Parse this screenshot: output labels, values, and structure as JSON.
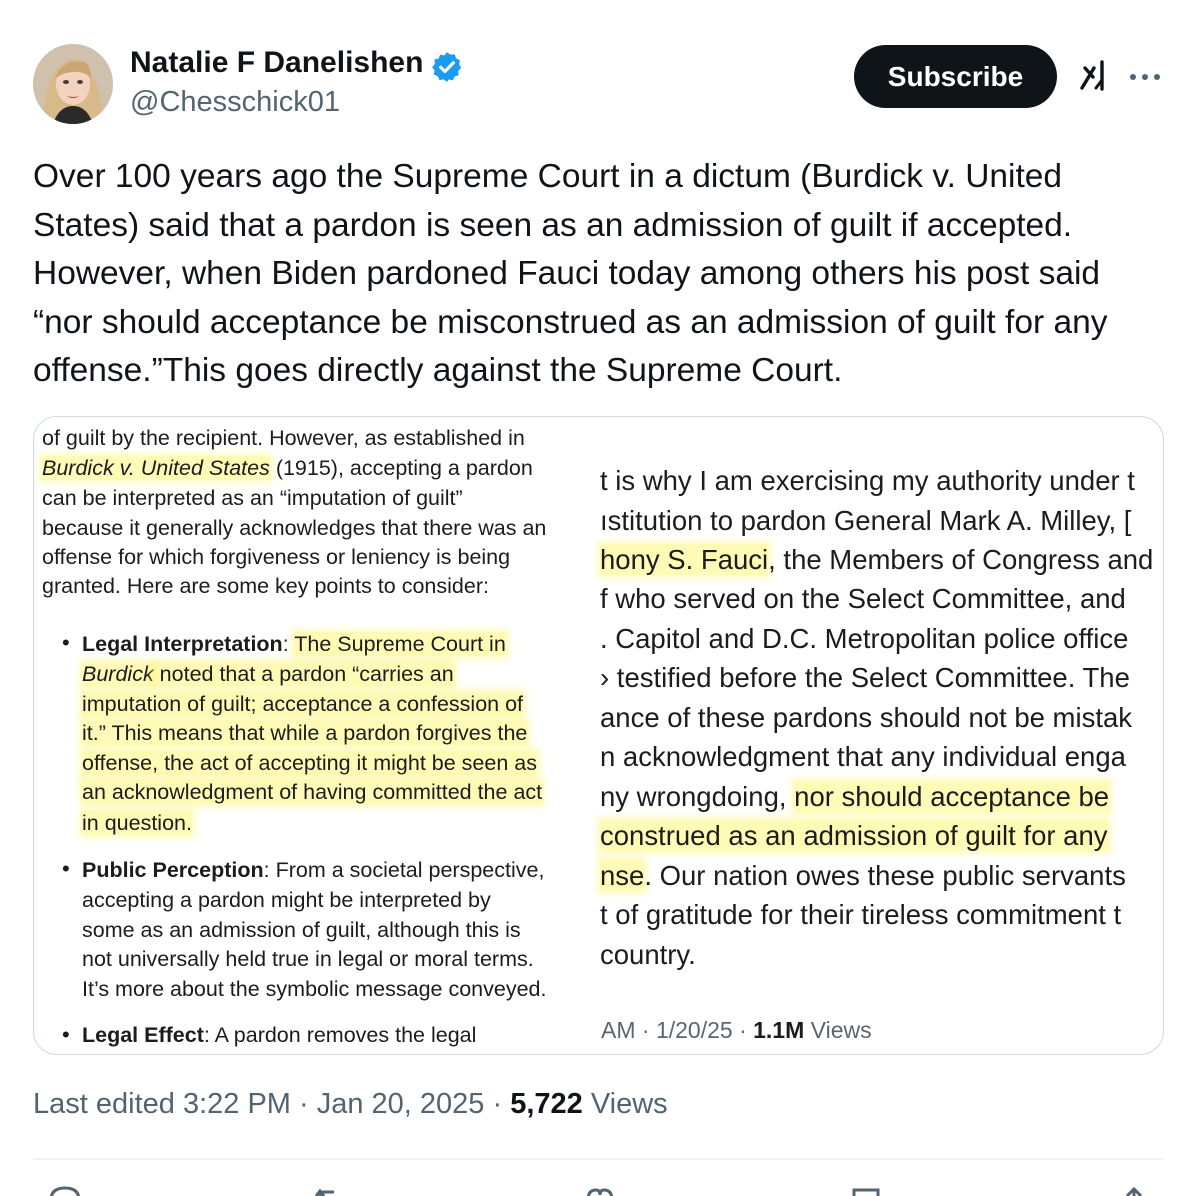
{
  "author": {
    "name": "Natalie F Danelishen",
    "handle": "@Chesschick01",
    "verified_color": "#1d9bf0"
  },
  "header": {
    "subscribe_label": "Subscribe",
    "grok_icon": "grok-icon",
    "more_icon": "more-icon"
  },
  "tweet": {
    "text": "Over 100 years ago the Supreme Court in a dictum (Burdick v. United States) said that a pardon is seen as an admission of guilt if accepted. However, when Biden pardoned Fauci today among others his post said “nor should acceptance be misconstrued as an admission of guilt for any offense.”This goes directly against the Supreme Court."
  },
  "media": {
    "left": {
      "p1": {
        "l1": "of guilt by the recipient. However, as established in",
        "l2_case": "Burdick v. United States",
        "l2_rest": " (1915), accepting a pardon",
        "l3": "can be interpreted as an “imputation of guilt”",
        "l4": "because it generally acknowledges that there was an",
        "l5": "offense for which forgiveness or leniency is being",
        "l6": "granted. Here are some key points to consider:"
      },
      "b1": {
        "title": "Legal Interpretation",
        "l1_rest": "The Supreme Court in",
        "l2_case": "Burdick",
        "l2_rest": " noted that a pardon “carries an",
        "l3": "imputation of guilt; acceptance a confession of",
        "l4": "it.” This means that while a pardon forgives the",
        "l5": "offense, the act of accepting it might be seen as",
        "l6": "an acknowledgment of having committed the act",
        "l7": "in question."
      },
      "b2": {
        "title": "Public Perception",
        "l1_rest": " From a societal perspective,",
        "l2": "accepting a pardon might be interpreted by",
        "l3": "some as an admission of guilt, although this is",
        "l4": "not universally held true in legal or moral terms.",
        "l5": "It’s more about the symbolic message conveyed."
      },
      "b3": {
        "title": "Legal Effect",
        "l1_rest": " A pardon removes the legal"
      }
    },
    "right": {
      "l1": "t is why I am exercising my authority under t",
      "l2": "ıstitution to pardon General Mark A. Milley, [",
      "l3_hl": "hony S. Fauci",
      "l3_rest": ", the Members of Congress and",
      "l4": "f who served on the Select Committee, and",
      "l5": ". Capitol and D.C. Metropolitan police office",
      "l6": "› testified before the Select Committee. The",
      "l7": "ance of these pardons should not be mistak",
      "l8": "n acknowledgment that any individual enga",
      "l9_pre": "ny wrongdoing, ",
      "l9_hl": "nor should acceptance be",
      "l10_hl": "construed as an admission of guilt for any",
      "l11_hl": "nse",
      "l11_rest": ". Our nation owes these public servants",
      "l12": "t of gratitude for their tireless commitment t",
      "l13": "country.",
      "meta_time": "AM · 1/20/25 · ",
      "meta_views": "1.1M",
      "meta_views_label": " Views"
    }
  },
  "meta": {
    "edited": "Last edited 3:22 PM · Jan 20, 2025 · ",
    "views_count": "5,722",
    "views_label": " Views"
  },
  "actions": [
    "reply-icon",
    "retweet-icon",
    "like-icon",
    "bookmark-icon",
    "share-icon"
  ]
}
